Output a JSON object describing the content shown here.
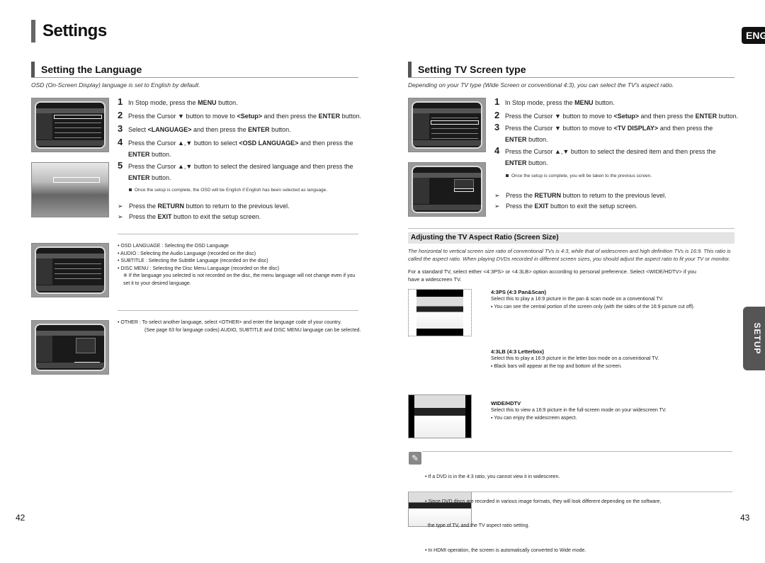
{
  "header": {
    "title": "Settings",
    "lang_badge": "ENG"
  },
  "side_tab": "SETUP",
  "left": {
    "section_title": "Setting the Language",
    "intro": "OSD  (On-Screen Display) language is set to English by default.",
    "steps": [
      {
        "num": "1",
        "html": "In Stop mode, press the <b>MENU</b> button."
      },
      {
        "num": "2",
        "html": "Press the Cursor ▼ button to move to <b>&lt;Setup&gt;</b> and then press the <b>ENTER</b> button."
      },
      {
        "num": "3",
        "html": "Select <b>&lt;LANGUAGE&gt;</b> and then press the <b>ENTER</b> button."
      },
      {
        "num": "4",
        "html": "Press the Cursor ▲,▼ button to select <b>&lt;OSD LANGUAGE&gt;</b> and then press the <b>ENTER</b> button."
      },
      {
        "num": "5",
        "html": "Press the Cursor ▲,▼ button to select the desired language and then press the <b>ENTER</b> button."
      }
    ],
    "step5_note": "Once the setup is complete, the OSD will be English if English has been selected as language.",
    "tips": [
      {
        "html": "Press the <b>RETURN</b> button to return to the previous level."
      },
      {
        "html": "Press the <b>EXIT</b> button to exit the setup screen."
      }
    ],
    "lang_items": [
      "• OSD LANGUAGE : Selecting the OSD Language",
      "• AUDIO : Selecting the Audio Language (recorded on the disc)",
      "• SUBTITLE : Selecting the Subtitle Language (recorded on the disc)",
      "• DISC MENU : Selecting the Disc Menu Language (recorded on the disc)"
    ],
    "lang_note": "※ If the language you selected is not recorded on the disc, the menu language will not change even if you set it to your desired language.",
    "other_label": "• OTHER : To select another language, select <OTHER> and enter the language code of your country.",
    "other_cont": "(See page 63 for language codes) AUDIO, SUBTITLE and DISC MENU language can be selected.",
    "page_number": "42"
  },
  "right": {
    "section_title": "Setting TV Screen type",
    "intro": "Depending on your TV type (Wide Screen  or conventional 4:3), you can select the TV's aspect ratio.",
    "steps": [
      {
        "num": "1",
        "html": "In Stop mode, press the <b>MENU</b> button."
      },
      {
        "num": "2",
        "html": "Press the Cursor ▼ button to move to <b>&lt;Setup&gt;</b> and then press the <b>ENTER</b> button."
      },
      {
        "num": "3",
        "html": "Press the Cursor ▼ button to move to <b>&lt;TV DISPLAY&gt;</b> and then press the <b>ENTER</b> button."
      },
      {
        "num": "4",
        "html": "Press the Cursor ▲,▼ button to select the desired item and then press the <b>ENTER</b> button."
      }
    ],
    "step4_note": "Once the setup is complete, you will be taken to the previous screen.",
    "tips": [
      {
        "html": "Press the <b>RETURN</b> button to return to the previous level."
      },
      {
        "html": "Press the <b>EXIT</b> button to exit the setup screen."
      }
    ],
    "aspect_title": "Adjusting the TV Aspect Ratio (Screen Size)",
    "aspect_intro": "The horizontal to vertical screen size ratio of conventional TVs is 4:3, while that of widescreen and high definition TVs is 16:9. This ratio is called the aspect ratio. When playing DVDs recorded in different screen sizes, you should adjust the aspect ratio to fit your TV or monitor.",
    "aspect_std": "For a standard TV, select either <4:3PS> or <4:3LB> option according to personal preference. Select <WIDE/HDTV> if you have a widescreen TV.",
    "modes": [
      {
        "title": "4:3PS (4:3 Pan&Scan)",
        "desc": "Select this to play a 16:9 picture in the pan & scan mode on a conventional TV.",
        "bullet": "You can see the central portion of the screen only (with the sides of the 16:9 picture cut off)."
      },
      {
        "title": "4:3LB (4:3 Letterbox)",
        "desc": "Select this to play a 16:9 picture in the letter box mode on a conventional TV.",
        "bullet": "Black bars will appear at the top and bottom of the screen."
      },
      {
        "title": "WIDE/HDTV",
        "desc": "Select this to view a 16:9 picture in the full-screen mode on your widescreen TV.",
        "bullet": "You can enjoy the widescreen aspect."
      }
    ],
    "notes": [
      "• If a DVD is in the 4:3 ratio, you cannot view it in widescreen.",
      "• Since DVD discs are recorded in various image formats, they will look different depending on the software,",
      "  the type of TV, and the TV aspect ratio setting.",
      "• In HDMI operation, the screen is automatically converted to Wide mode."
    ],
    "page_number": "43"
  }
}
